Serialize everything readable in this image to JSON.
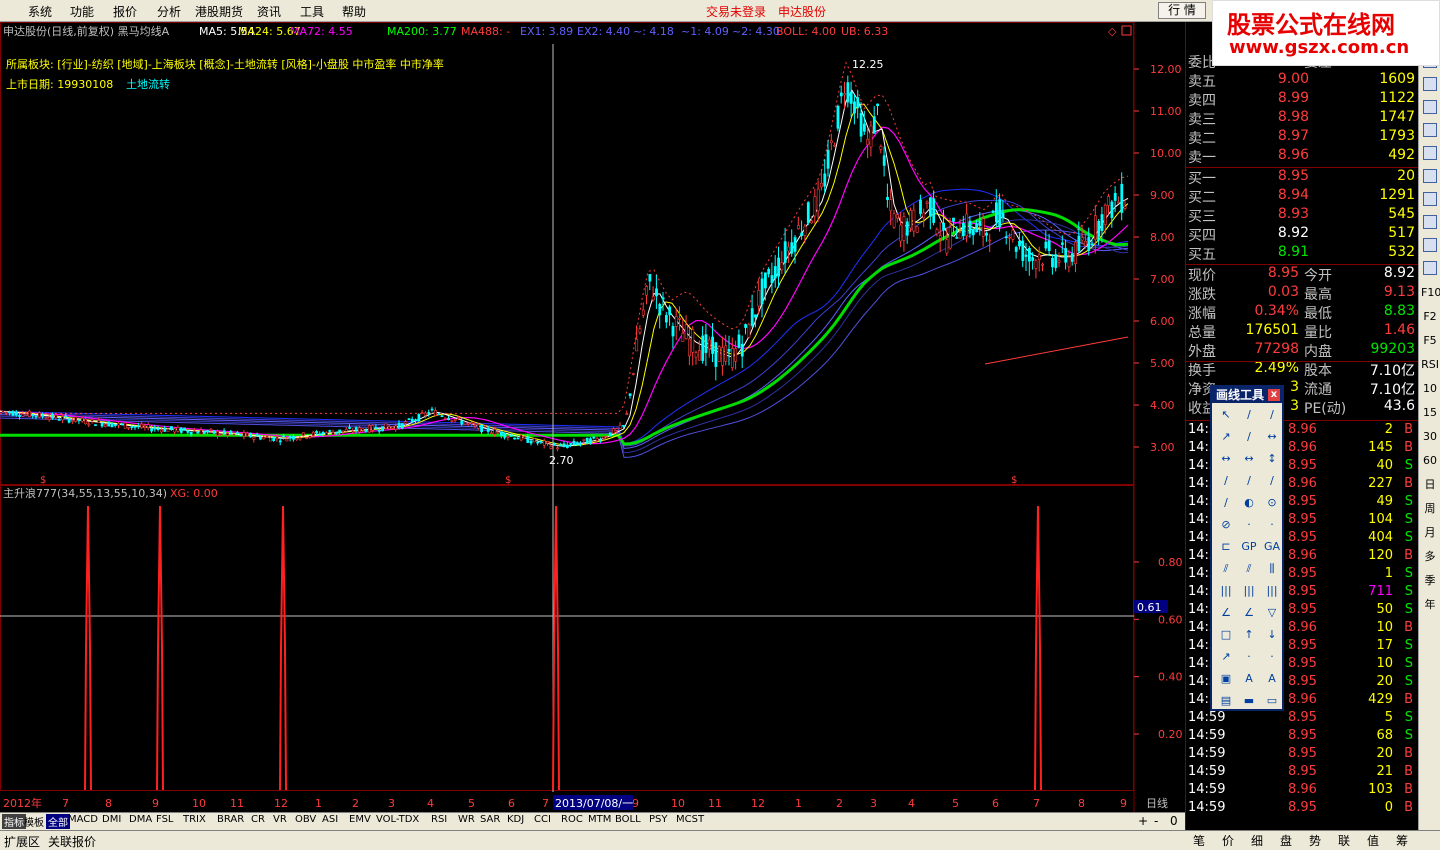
{
  "menubar": {
    "items": [
      "系统",
      "功能",
      "报价",
      "分析",
      "港股期货",
      "资讯",
      "工具",
      "帮助"
    ],
    "status_trade": "交易未登录",
    "status_stock": "申达股份",
    "hq_button": "行 情"
  },
  "logo": {
    "title": "股票公式在线网",
    "url": "www.gszx.com.cn"
  },
  "chart": {
    "title": "申达股份(日线,前复权) 黑马均线A",
    "ma_labels": [
      {
        "text": "MA5: 5.54",
        "color": "#ffffff"
      },
      {
        "text": "MA24: 5.67",
        "color": "#ffff00"
      },
      {
        "text": "MA72: 4.55",
        "color": "#ff00ff"
      },
      {
        "text": "MA200: 3.77",
        "color": "#00ff00"
      },
      {
        "text": "MA488: -",
        "color": "#ff3c3c"
      },
      {
        "text": "EX1: 3.89",
        "color": "#6060ff"
      },
      {
        "text": "EX2: 4.40",
        "color": "#6060ff"
      },
      {
        "text": "~: 4.18",
        "color": "#6060ff"
      },
      {
        "text": "~1: 4.09",
        "color": "#6060ff"
      },
      {
        "text": "~2: 4.30",
        "color": "#6060ff"
      },
      {
        "text": "BOLL: 4.00",
        "color": "#ff3c3c"
      },
      {
        "text": "UB: 6.33",
        "color": "#ff3c3c"
      }
    ],
    "sector_info": "所属板块: [行业]-纺织 [地域]-上海板块 [概念]-土地流转 [风格]-小盘股 中市盈率 中市净率",
    "list_date_label": "上市日期: 19930108",
    "list_date_concept": "土地流转",
    "price_axis": [
      "12.00",
      "11.00",
      "10.00",
      "9.00",
      "8.00",
      "7.00",
      "6.00",
      "5.00",
      "4.00",
      "3.00"
    ],
    "high_label": "12.25",
    "low_label": "2.70",
    "indicator_title": "主升浪777(34,55,13,55,10,34)",
    "indicator_xg": "XG: 0.00",
    "indicator_axis": [
      "0.80",
      "0.60",
      "0.40",
      "0.20"
    ],
    "indicator_cursor_value": "0.61",
    "date_axis": [
      "2012年",
      "7",
      "8",
      "9",
      "10",
      "11",
      "12",
      "1",
      "2",
      "3",
      "4",
      "5",
      "6",
      "7",
      "9",
      "10",
      "11",
      "12",
      "1",
      "2",
      "3",
      "4",
      "5",
      "6",
      "7",
      "8",
      "9"
    ],
    "date_cursor": "2013/07/08/一",
    "period_label": "日线"
  },
  "orderbook": {
    "weibi_label": "委比",
    "weicha_label": "委差",
    "sell": [
      {
        "label": "卖五",
        "price": "9.00",
        "vol": "1609",
        "pc": "red"
      },
      {
        "label": "卖四",
        "price": "8.99",
        "vol": "1122",
        "pc": "red"
      },
      {
        "label": "卖三",
        "price": "8.98",
        "vol": "1747",
        "pc": "red"
      },
      {
        "label": "卖二",
        "price": "8.97",
        "vol": "1793",
        "pc": "red"
      },
      {
        "label": "卖一",
        "price": "8.96",
        "vol": "492",
        "pc": "red"
      }
    ],
    "buy": [
      {
        "label": "买一",
        "price": "8.95",
        "vol": "20",
        "pc": "red"
      },
      {
        "label": "买二",
        "price": "8.94",
        "vol": "1291",
        "pc": "red"
      },
      {
        "label": "买三",
        "price": "8.93",
        "vol": "545",
        "pc": "red"
      },
      {
        "label": "买四",
        "price": "8.92",
        "vol": "517",
        "pc": "white"
      },
      {
        "label": "买五",
        "price": "8.91",
        "vol": "532",
        "pc": "green"
      }
    ]
  },
  "stats": [
    {
      "l1": "现价",
      "v1": "8.95",
      "c1": "red",
      "l2": "今开",
      "v2": "8.92",
      "c2": "white"
    },
    {
      "l1": "涨跌",
      "v1": "0.03",
      "c1": "red",
      "l2": "最高",
      "v2": "9.13",
      "c2": "red"
    },
    {
      "l1": "涨幅",
      "v1": "0.34%",
      "c1": "red",
      "l2": "最低",
      "v2": "8.83",
      "c2": "green"
    },
    {
      "l1": "总量",
      "v1": "176501",
      "c1": "yellow",
      "l2": "量比",
      "v2": "1.46",
      "c2": "red"
    },
    {
      "l1": "外盘",
      "v1": "77298",
      "c1": "red",
      "l2": "内盘",
      "v2": "99203",
      "c2": "green"
    },
    {
      "l1": "换手",
      "v1": "2.49%",
      "c1": "yellow",
      "l2": "股本",
      "v2": "7.10亿",
      "c2": "white"
    },
    {
      "l1": "净资",
      "v1": "3",
      "c1": "yellow",
      "l2": "流通",
      "v2": "7.10亿",
      "c2": "white"
    },
    {
      "l1": "收益",
      "v1": "3",
      "c1": "yellow",
      "l2": "PE(动)",
      "v2": "43.6",
      "c2": "white"
    }
  ],
  "ticks": [
    {
      "t": "14:5",
      "p": "8.96",
      "v": "2",
      "vc": "yellow",
      "s": "B"
    },
    {
      "t": "14:5",
      "p": "8.96",
      "v": "145",
      "vc": "yellow",
      "s": "B"
    },
    {
      "t": "14:5",
      "p": "8.95",
      "v": "40",
      "vc": "yellow",
      "s": "S"
    },
    {
      "t": "14:5",
      "p": "8.96",
      "v": "227",
      "vc": "yellow",
      "s": "B"
    },
    {
      "t": "14:5",
      "p": "8.95",
      "v": "49",
      "vc": "yellow",
      "s": "S"
    },
    {
      "t": "14:5",
      "p": "8.95",
      "v": "104",
      "vc": "yellow",
      "s": "S"
    },
    {
      "t": "14:5",
      "p": "8.95",
      "v": "404",
      "vc": "yellow",
      "s": "S"
    },
    {
      "t": "14:5",
      "p": "8.96",
      "v": "120",
      "vc": "yellow",
      "s": "B"
    },
    {
      "t": "14:5",
      "p": "8.95",
      "v": "1",
      "vc": "yellow",
      "s": "S"
    },
    {
      "t": "14:5",
      "p": "8.95",
      "v": "711",
      "vc": "magenta",
      "s": "S"
    },
    {
      "t": "14:5",
      "p": "8.95",
      "v": "50",
      "vc": "yellow",
      "s": "S"
    },
    {
      "t": "14:5",
      "p": "8.96",
      "v": "10",
      "vc": "yellow",
      "s": "B"
    },
    {
      "t": "14:5",
      "p": "8.95",
      "v": "17",
      "vc": "yellow",
      "s": "S"
    },
    {
      "t": "14:5",
      "p": "8.95",
      "v": "10",
      "vc": "yellow",
      "s": "S"
    },
    {
      "t": "14:5",
      "p": "8.95",
      "v": "20",
      "vc": "yellow",
      "s": "S"
    },
    {
      "t": "14:5",
      "p": "8.96",
      "v": "429",
      "vc": "yellow",
      "s": "B"
    },
    {
      "t": "14:59",
      "p": "8.95",
      "v": "5",
      "vc": "yellow",
      "s": "S"
    },
    {
      "t": "14:59",
      "p": "8.95",
      "v": "68",
      "vc": "yellow",
      "s": "S"
    },
    {
      "t": "14:59",
      "p": "8.95",
      "v": "20",
      "vc": "yellow",
      "s": "B"
    },
    {
      "t": "14:59",
      "p": "8.95",
      "v": "21",
      "vc": "yellow",
      "s": "B"
    },
    {
      "t": "14:59",
      "p": "8.96",
      "v": "103",
      "vc": "yellow",
      "s": "B"
    },
    {
      "t": "14:59",
      "p": "8.95",
      "v": "0",
      "vc": "yellow",
      "s": "B"
    }
  ],
  "right_toolbar": [
    "F10",
    "F2",
    "F5",
    "RSI",
    "10",
    "15",
    "30",
    "60",
    "日",
    "周",
    "月",
    "多",
    "季",
    "年"
  ],
  "draw_tools": {
    "title": "画线工具",
    "close": "x",
    "text_buttons": [
      "GP",
      "GA",
      "A",
      "A"
    ]
  },
  "bottom_tabs": [
    "指标",
    "模板",
    "全部",
    "MACD",
    "DMI",
    "DMA",
    "FSL",
    "TRIX",
    "BRAR",
    "CR",
    "VR",
    "OBV",
    "ASI",
    "EMV",
    "VOL-TDX",
    "RSI",
    "WR",
    "SAR",
    "KDJ",
    "CCI",
    "ROC",
    "MTM",
    "BOLL",
    "PSY",
    "MCST"
  ],
  "zoom_controls": [
    "+",
    "-",
    "0"
  ],
  "status_bar": [
    "扩展区",
    "关联报价"
  ],
  "right_bottom_tabs": [
    "笔",
    "价",
    "细",
    "盘",
    "势",
    "联",
    "值",
    "筹"
  ]
}
